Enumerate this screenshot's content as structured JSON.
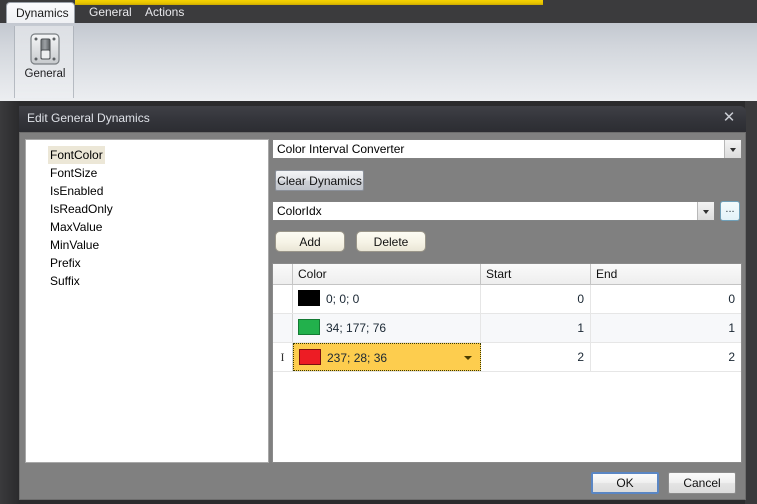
{
  "ribbon": {
    "tabs": [
      {
        "label": "Dynamics",
        "active": true
      },
      {
        "label": "General",
        "active": false
      },
      {
        "label": "Actions",
        "active": false
      }
    ],
    "group_button": {
      "label": "General",
      "icon": "toggle-switch-icon"
    }
  },
  "dialog": {
    "title": "Edit General Dynamics",
    "close_icon": "close-icon",
    "property_list": [
      {
        "label": "FontColor",
        "selected": true
      },
      {
        "label": "FontSize",
        "selected": false
      },
      {
        "label": "IsEnabled",
        "selected": false
      },
      {
        "label": "IsReadOnly",
        "selected": false
      },
      {
        "label": "MaxValue",
        "selected": false
      },
      {
        "label": "MinValue",
        "selected": false
      },
      {
        "label": "Prefix",
        "selected": false
      },
      {
        "label": "Suffix",
        "selected": false
      }
    ],
    "converter_combo": {
      "value": "Color Interval Converter",
      "arrow_icon": "chevron-down-icon"
    },
    "clear_button": "Clear Dynamics",
    "source_combo": {
      "value": "ColorIdx",
      "arrow_icon": "chevron-down-icon"
    },
    "browse_button": "...",
    "add_button": "Add",
    "delete_button": "Delete",
    "grid": {
      "columns": [
        "",
        "Color",
        "Start",
        "End"
      ],
      "rows": [
        {
          "row_indicator": "",
          "color_text": "0; 0; 0",
          "color_hex": "#000000",
          "start": "0",
          "end": "0",
          "selected": false
        },
        {
          "row_indicator": "",
          "color_text": "34; 177; 76",
          "color_hex": "#22b14c",
          "start": "1",
          "end": "1",
          "selected": false
        },
        {
          "row_indicator": "I",
          "color_text": "237; 28; 36",
          "color_hex": "#ed1c24",
          "start": "2",
          "end": "2",
          "selected": true
        }
      ]
    },
    "ok_button": "OK",
    "cancel_button": "Cancel"
  },
  "colors": {
    "accent_gold": "#e8c400",
    "selection_amber": "#fdcd4e",
    "dialog_body": "#808080",
    "titlebar": "#33343a"
  }
}
